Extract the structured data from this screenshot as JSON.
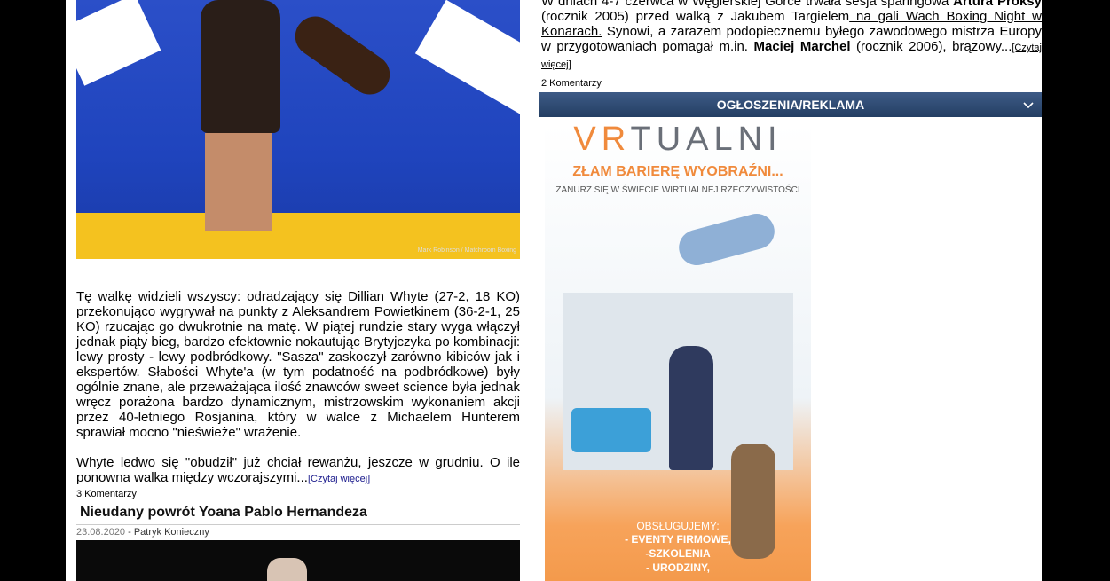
{
  "left_article": {
    "photo_caption": "Mark Robinson / Matchroom Boxing",
    "paragraph1": "Tę walkę widzieli wszyscy: odradzający się Dillian Whyte (27-2, 18 KO) przekonująco wygrywał na punkty z Aleksandrem Powietkinem (36-2-1, 25 KO) rzucając go dwukrotnie na matę. W piątej rundzie stary wyga włączył jednak piąty bieg, bardzo efektownie nokautując Brytyjczyka po kombinacji: lewy prosty - lewy podbródkowy. \"Sasza\" zaskoczył zarówno kibiców jak i ekspertów. Słabości Whyte'a (w tym podatność na podbródkowe) były ogólnie znane, ale przeważająca ilość znawców sweet science była jednak wręcz porażona bardzo dynamicznym, mistrzowskim wykonaniem akcji przez 40-letniego Rosjanina, który w walce z Michaelem Hunterem sprawiał mocno \"nieświeże\" wrażenie.",
    "paragraph2": "Whyte ledwo się \"obudził\" już chciał rewanżu, jeszcze w grudniu. O ile ponowna walka między wczorajszymi...",
    "read_more": "[Czytaj więcej]",
    "comments": "3 Komentarzy"
  },
  "next_article": {
    "title": "Nieudany powrót Yoana Pablo Hernandeza",
    "date": "23.08.2020",
    "separator": " - ",
    "author": "Patryk Konieczny"
  },
  "right_article": {
    "text_start": "W dniach 4-7 czerwca w Węglerskiej Górce trwała sesja sparingowa ",
    "bold1": "Artura Proksy",
    "text2": " (rocznik 2005) przed walką z Jakubem Targielem",
    "link": " na gali Wach Boxing Night w Konarach.",
    "text3": " Synowi, a zarazem podopiecznemu byłego zawodowego mistrza Europy w przygotowaniach pomagał m.in. ",
    "bold2": "Maciej Marchel",
    "text4": " (rocznik 2006), brązowy...",
    "read_more": "[Czytaj więcej]",
    "comments": "2 Komentarzy"
  },
  "sidebar_band": {
    "label": "OGŁOSZENIA/REKLAMA",
    "chevron": "chevron-down-icon"
  },
  "ad": {
    "logo_vr": "VR",
    "logo_rest": "TUALNI",
    "slogan": "ZŁAM BARIERĘ WYOBRAŹNI...",
    "subtitle": "ZANURZ SIĘ W ŚWIECIE WIRTUALNEJ RZECZYWISTOŚCI",
    "services_header": "OBSŁUGUJEMY:",
    "services": [
      "- EVENTY FIRMOWE,",
      "-SZKOLENIA",
      "- URODZINY,"
    ]
  }
}
